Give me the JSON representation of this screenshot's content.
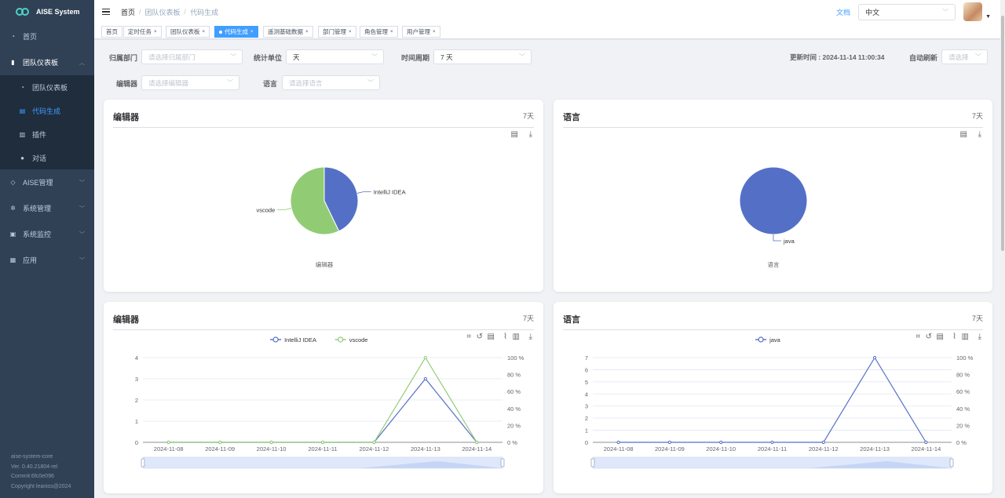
{
  "app": {
    "name": "AISE System"
  },
  "sidebar": {
    "items": [
      {
        "label": "首页",
        "icon": "dashboard-icon"
      },
      {
        "label": "团队仪表板",
        "icon": "bar-chart-icon",
        "expanded": true,
        "children": [
          {
            "label": "团队仪表板",
            "icon": "dashboard-icon"
          },
          {
            "label": "代码生成",
            "icon": "code-icon",
            "active": true
          },
          {
            "label": "插件",
            "icon": "plugin-icon"
          },
          {
            "label": "对话",
            "icon": "chat-icon"
          }
        ]
      },
      {
        "label": "AISE管理",
        "icon": "cube-icon"
      },
      {
        "label": "系统管理",
        "icon": "gear-icon"
      },
      {
        "label": "系统监控",
        "icon": "monitor-icon"
      },
      {
        "label": "应用",
        "icon": "app-icon"
      }
    ],
    "version": [
      "aise-system-core",
      "Ver. 0.40.21804-rel",
      "Commit:6fc0e096",
      "Copyright leaniss@2024"
    ]
  },
  "navbar": {
    "breadcrumb": [
      "首页",
      "团队仪表板",
      "代码生成"
    ],
    "doc_link": "文档",
    "language": "中文"
  },
  "tags": [
    {
      "label": "首页"
    },
    {
      "label": "定时任务"
    },
    {
      "label": "团队仪表板"
    },
    {
      "label": "代码生成",
      "active": true
    },
    {
      "label": "遥测基础数据"
    },
    {
      "label": "部门管理"
    },
    {
      "label": "角色管理"
    },
    {
      "label": "用户管理"
    }
  ],
  "filters": {
    "dept_label": "归属部门",
    "dept_placeholder": "请选择归属部门",
    "unit_label": "统计单位",
    "unit_value": "天",
    "period_label": "时间周期",
    "period_value": "7 天",
    "update_time": "更新时间 : 2024-11-14 11:00:34",
    "refresh_label": "自动刷新",
    "refresh_placeholder": "请选择",
    "editor_label": "编辑器",
    "editor_placeholder": "请选择编辑器",
    "lang_label": "语言",
    "lang_placeholder": "请选择语言"
  },
  "cards": {
    "editor_pie": {
      "title": "编辑器",
      "period": "7天"
    },
    "lang_pie": {
      "title": "语言",
      "period": "7天"
    },
    "editor_line": {
      "title": "编辑器",
      "period": "7天"
    },
    "lang_line": {
      "title": "语言",
      "period": "7天"
    }
  },
  "colors": {
    "blue": "#5470c6",
    "green": "#91cc75",
    "accent": "#409eff",
    "sidebar": "#304156"
  },
  "chart_data": [
    {
      "type": "pie",
      "title": "编辑器",
      "categories": [
        "IntelliJ IDEA",
        "vscode"
      ],
      "values": [
        3,
        4
      ]
    },
    {
      "type": "pie",
      "title": "语言",
      "categories": [
        "java"
      ],
      "values": [
        7
      ]
    },
    {
      "type": "line",
      "x": [
        "2024-11-08",
        "2024-11-09",
        "2024-11-10",
        "2024-11-11",
        "2024-11-12",
        "2024-11-13",
        "2024-11-14"
      ],
      "series": [
        {
          "name": "IntelliJ IDEA",
          "values": [
            0,
            0,
            0,
            0,
            0,
            3,
            0
          ]
        },
        {
          "name": "vscode",
          "values": [
            0,
            0,
            0,
            0,
            0,
            4,
            0
          ]
        }
      ],
      "yticks": [
        "0",
        "1",
        "2",
        "3",
        "4"
      ],
      "ylim": [
        0,
        4
      ],
      "y2ticks": [
        "0 %",
        "20 %",
        "40 %",
        "60 %",
        "80 %",
        "100 %"
      ],
      "legend": "top-center",
      "grid": true
    },
    {
      "type": "line",
      "x": [
        "2024-11-08",
        "2024-11-09",
        "2024-11-10",
        "2024-11-11",
        "2024-11-12",
        "2024-11-13",
        "2024-11-14"
      ],
      "series": [
        {
          "name": "java",
          "values": [
            0,
            0,
            0,
            0,
            0,
            7,
            0
          ]
        }
      ],
      "yticks": [
        "0",
        "1",
        "2",
        "3",
        "4",
        "5",
        "6",
        "7"
      ],
      "ylim": [
        0,
        7
      ],
      "y2ticks": [
        "0 %",
        "20 %",
        "40 %",
        "60 %",
        "80 %",
        "100 %"
      ],
      "legend": "top-center",
      "grid": true
    }
  ]
}
